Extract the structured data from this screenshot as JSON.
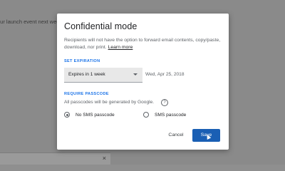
{
  "background": {
    "email_snippet": "our launch event next week.",
    "snackbar_close": "×"
  },
  "dialog": {
    "title": "Confidential mode",
    "description": "Recipients will not have the option to forward email contents, copy/paste, download, nor print.",
    "learn_more": "Learn more",
    "expiration": {
      "label": "SET EXPIRATION",
      "selected": "Expires in 1 week",
      "date": "Wed, Apr 25, 2018"
    },
    "passcode": {
      "label": "REQUIRE PASSCODE",
      "description": "All passcodes will be generated by Google.",
      "help_icon": "?",
      "options": [
        "No SMS passcode",
        "SMS passcode"
      ],
      "selected": "No SMS passcode"
    },
    "buttons": {
      "cancel": "Cancel",
      "save": "Save"
    }
  },
  "colors": {
    "accent": "#1a73e8",
    "primary_button": "#1a5fb4"
  }
}
